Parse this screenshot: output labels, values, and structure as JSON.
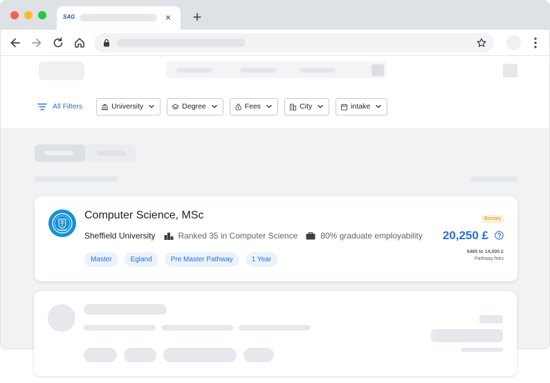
{
  "browser": {
    "tab": {
      "favicon_text": "SAG",
      "close_label": "×"
    },
    "new_tab_label": "+"
  },
  "filters": {
    "all_filters_label": "All Filters",
    "chips": [
      {
        "label": "University",
        "icon": "university-icon"
      },
      {
        "label": "Degree",
        "icon": "graduation-cap-icon"
      },
      {
        "label": "Fees",
        "icon": "money-bag-icon"
      },
      {
        "label": "City",
        "icon": "building-icon"
      },
      {
        "label": "intake",
        "icon": "calendar-icon"
      }
    ]
  },
  "course_card": {
    "title": "Computer Science, MSc",
    "university": "Sheffield University",
    "ranking": "Ranked 35 in Computer Science",
    "employability": "80% graduate employability",
    "tags": [
      "Master",
      "Egland",
      "Pre Master Pathway",
      "1 Year"
    ],
    "badge": "Bursary",
    "price": "20,250 £",
    "fees_range": "5465 to 14,000 £",
    "fees_label": "Pathway fees"
  },
  "colors": {
    "accent": "#2b6fd6",
    "badge_bg": "#fdf1d7",
    "badge_text": "#c99213",
    "logo_bg": "#1690d6"
  }
}
